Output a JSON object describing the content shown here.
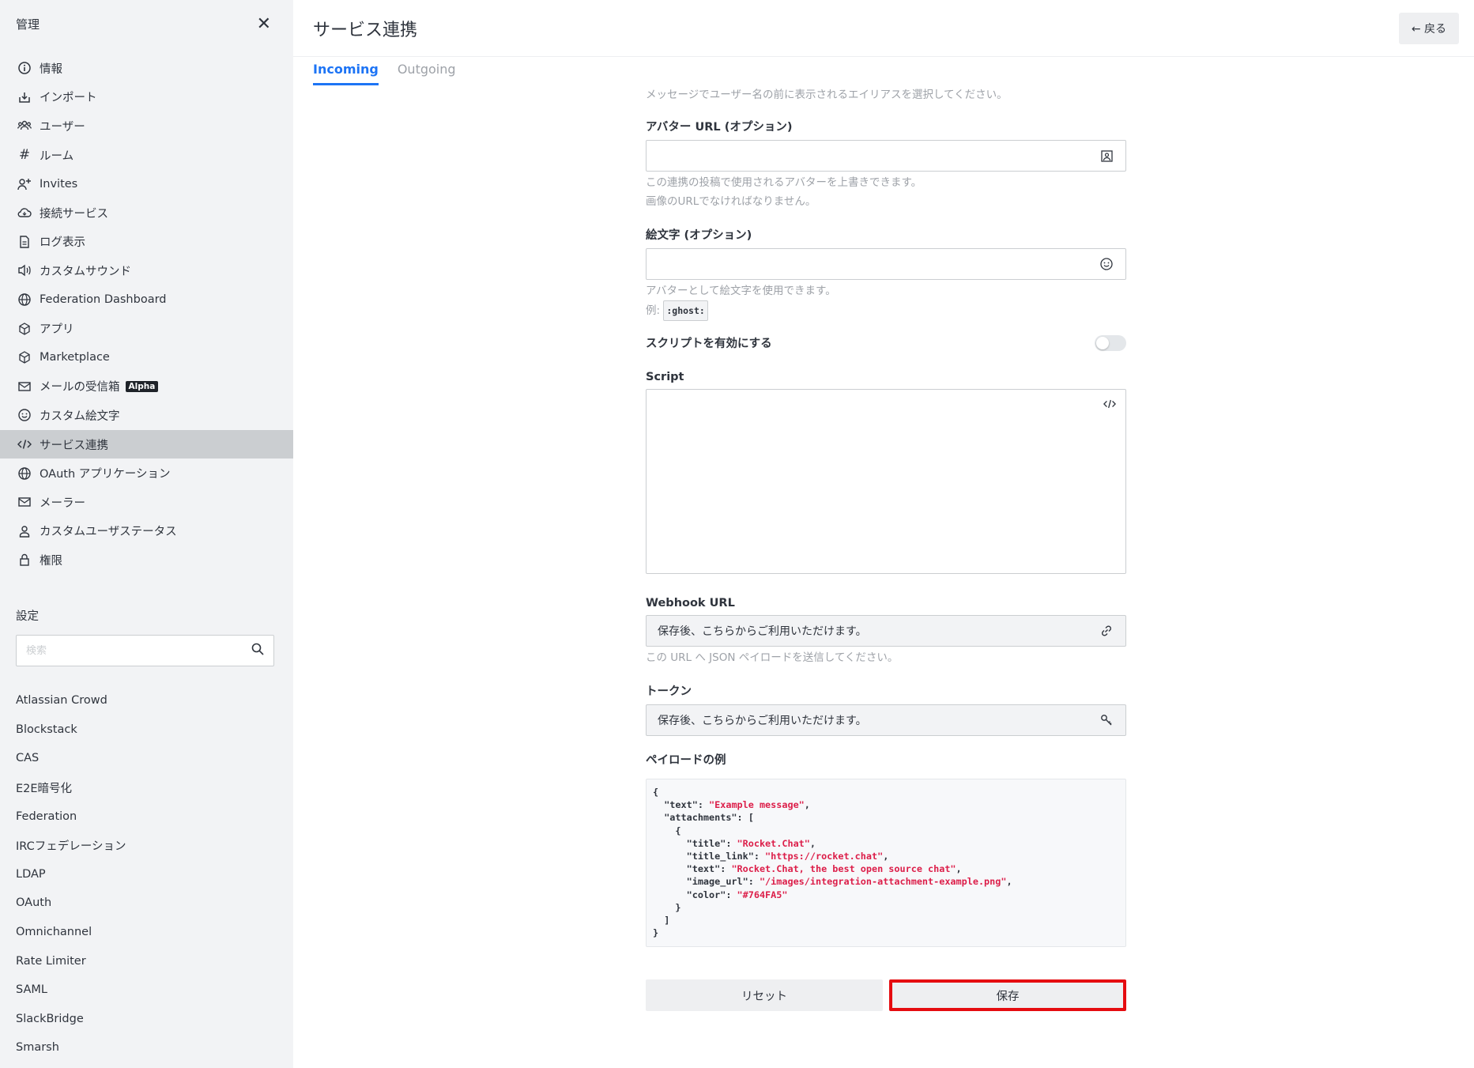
{
  "sidebar": {
    "title": "管理",
    "items": [
      {
        "label": "情報",
        "icon": "info-circle-icon"
      },
      {
        "label": "インポート",
        "icon": "import-icon"
      },
      {
        "label": "ユーザー",
        "icon": "users-icon"
      },
      {
        "label": "ルーム",
        "icon": "hashtag-icon"
      },
      {
        "label": "Invites",
        "icon": "user-plus-icon"
      },
      {
        "label": "接続サービス",
        "icon": "cloud-icon"
      },
      {
        "label": "ログ表示",
        "icon": "document-icon"
      },
      {
        "label": "カスタムサウンド",
        "icon": "volume-icon"
      },
      {
        "label": "Federation Dashboard",
        "icon": "globe-icon"
      },
      {
        "label": "アプリ",
        "icon": "cube-icon"
      },
      {
        "label": "Marketplace",
        "icon": "cube-icon"
      },
      {
        "label": "メールの受信箱",
        "icon": "mail-icon",
        "badge": "Alpha"
      },
      {
        "label": "カスタム絵文字",
        "icon": "emoji-icon"
      },
      {
        "label": "サービス連携",
        "icon": "code-icon",
        "active": true
      },
      {
        "label": "OAuth アプリケーション",
        "icon": "globe-icon"
      },
      {
        "label": "メーラー",
        "icon": "mail-icon"
      },
      {
        "label": "カスタムユーザステータス",
        "icon": "user-icon"
      },
      {
        "label": "権限",
        "icon": "lock-icon"
      }
    ],
    "settings_label": "設定",
    "search_placeholder": "検索",
    "settings_items": [
      "Atlassian Crowd",
      "Blockstack",
      "CAS",
      "E2E暗号化",
      "Federation",
      "IRCフェデレーション",
      "LDAP",
      "OAuth",
      "Omnichannel",
      "Rate Limiter",
      "SAML",
      "SlackBridge",
      "Smarsh"
    ]
  },
  "header": {
    "title": "サービス連携",
    "back_label": "← 戻る"
  },
  "tabs": [
    {
      "label": "Incoming",
      "active": true
    },
    {
      "label": "Outgoing",
      "active": false
    }
  ],
  "form": {
    "alias_hint": "メッセージでユーザー名の前に表示されるエイリアスを選択してください。",
    "avatar_label": "アバター URL (オプション)",
    "avatar_value": "",
    "avatar_hint_1": "この連携の投稿で使用されるアバターを上書きできます。",
    "avatar_hint_2": "画像のURLでなければなりません。",
    "emoji_label": "絵文字 (オプション)",
    "emoji_value": "",
    "emoji_hint": "アバターとして絵文字を使用できます。",
    "emoji_example_prefix": "例:",
    "emoji_example_code": ":ghost:",
    "script_toggle_label": "スクリプトを有効にする",
    "script_enabled": false,
    "script_label": "Script",
    "webhook_label": "Webhook URL",
    "webhook_value": "保存後、こちらからご利用いただけます。",
    "webhook_hint": "この URL へ JSON ペイロードを送信してください。",
    "token_label": "トークン",
    "token_value": "保存後、こちらからご利用いただけます。",
    "payload_label": "ペイロードの例",
    "payload": {
      "text": "\"Example message\"",
      "title": "\"Rocket.Chat\"",
      "title_link": "\"https://rocket.chat\"",
      "att_text": "\"Rocket.Chat, the best open source chat\"",
      "image_url": "\"/images/integration-attachment-example.png\"",
      "color": "\"#764FA5\""
    },
    "reset_label": "リセット",
    "save_label": "保存"
  }
}
